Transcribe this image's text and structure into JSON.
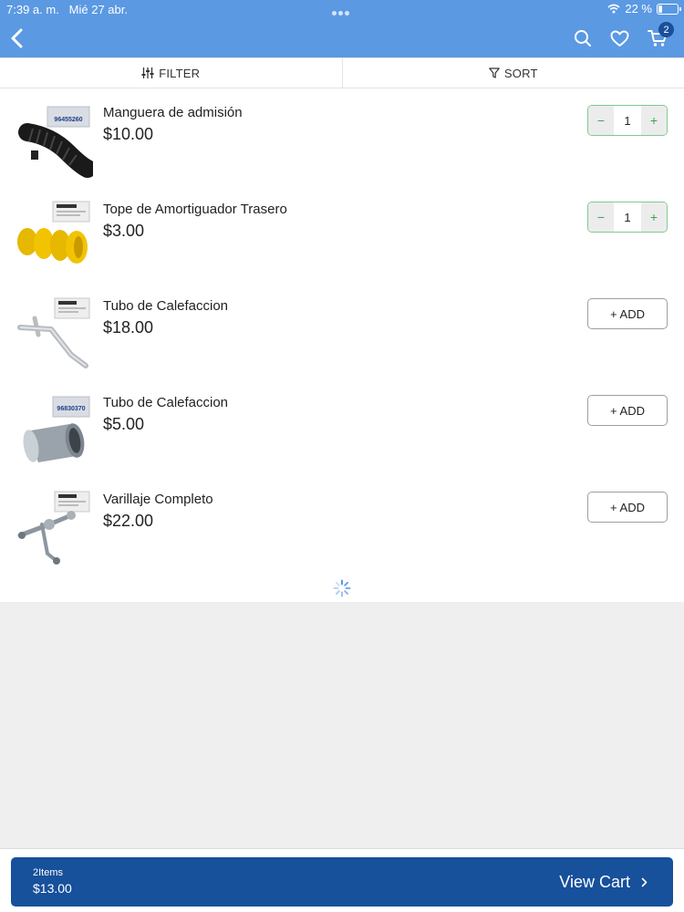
{
  "status_bar": {
    "time": "7:39 a. m.",
    "date": "Mié 27 abr.",
    "battery": "22 %"
  },
  "header": {
    "cart_count": "2"
  },
  "toolbar": {
    "filter_label": "FILTER",
    "sort_label": "SORT"
  },
  "products": [
    {
      "name": "Manguera de admisión",
      "price": "$10.00",
      "quantity": "1",
      "label": "96455260",
      "image": "intake-hose"
    },
    {
      "name": "Tope de Amortiguador Trasero",
      "price": "$3.00",
      "quantity": "1",
      "image": "shock-bumper"
    },
    {
      "name": "Tubo de Calefaccion",
      "price": "$18.00",
      "add_label": "+ ADD",
      "image": "heater-tube"
    },
    {
      "name": "Tubo de Calefaccion",
      "price": "$5.00",
      "add_label": "+ ADD",
      "label": "96830370",
      "image": "metal-sleeve"
    },
    {
      "name": "Varillaje Completo",
      "price": "$22.00",
      "add_label": "+ ADD",
      "image": "linkage"
    }
  ],
  "cart_bar": {
    "items": "2Items",
    "total": "$13.00",
    "view_label": "View Cart"
  },
  "colors": {
    "header": "#5b99e3",
    "cart_bar": "#17509b",
    "stepper_border": "#7ecb8f",
    "badge": "#1a4f9a"
  }
}
